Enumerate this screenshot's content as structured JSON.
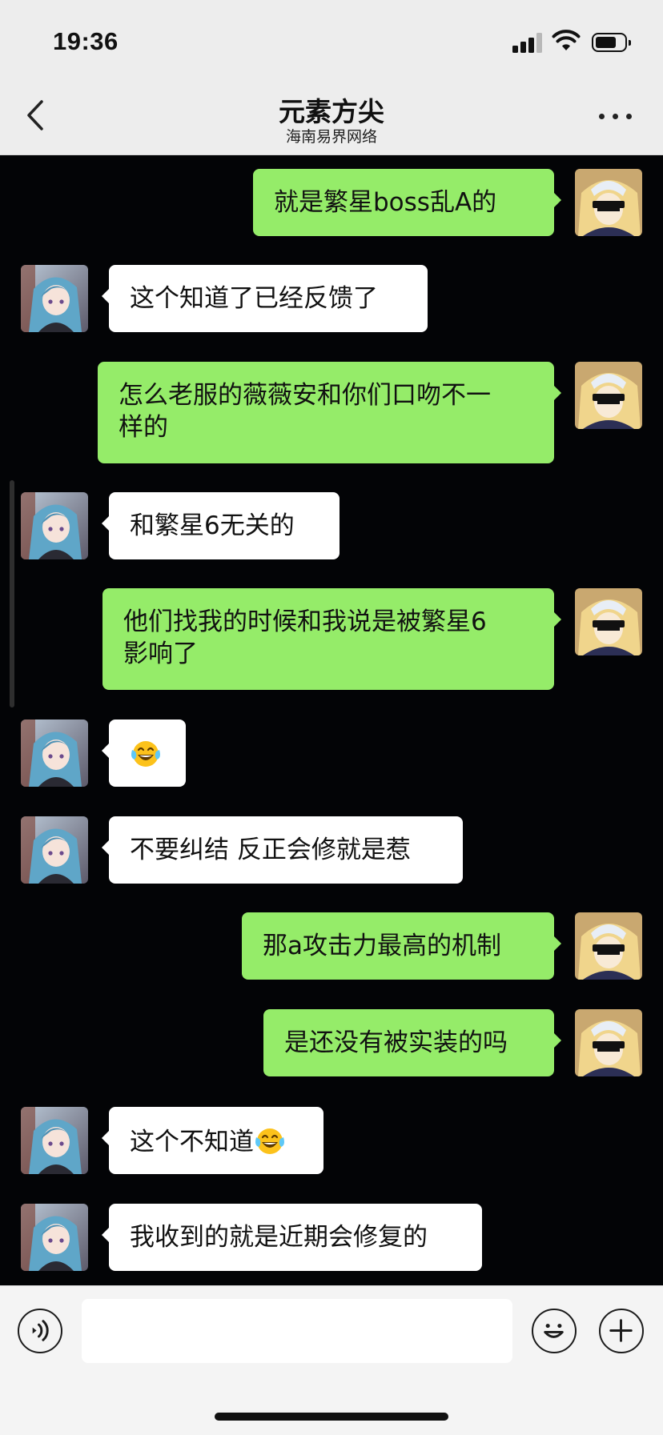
{
  "status_bar": {
    "time": "19:36"
  },
  "header": {
    "title": "元素方尖",
    "subtitle": "海南易界网络"
  },
  "messages": [
    {
      "side": "me",
      "text": "就是繁星boss乱A的"
    },
    {
      "side": "you",
      "text": "这个知道了已经反馈了"
    },
    {
      "side": "me",
      "text": "怎么老服的薇薇安和你们口吻不一\n样的"
    },
    {
      "side": "you",
      "text": "和繁星6无关的"
    },
    {
      "side": "me",
      "text": "他们找我的时候和我说是被繁星6\n影响了"
    },
    {
      "side": "you",
      "text": "",
      "emoji": "laughing-tears-emoji"
    },
    {
      "side": "you",
      "text": "不要纠结 反正会修就是惹"
    },
    {
      "side": "me",
      "text": "那a攻击力最高的机制"
    },
    {
      "side": "me",
      "text": "是还没有被实装的吗"
    },
    {
      "side": "you",
      "text": "这个不知道",
      "emoji": "laughing-tears-emoji"
    },
    {
      "side": "you",
      "text": "我收到的就是近期会修复的"
    }
  ],
  "input_bar": {
    "text_value": "",
    "placeholder": ""
  },
  "icons": {
    "back": "chevron-left-icon",
    "more": "ellipsis-icon",
    "voice": "voice-icon",
    "emoji": "emoji-icon",
    "add": "plus-icon"
  },
  "colors": {
    "header_bg": "#ededed",
    "chat_bg": "#030406",
    "my_bubble": "#95ec69",
    "their_bubble": "#ffffff",
    "input_bar_bg": "#f4f4f4"
  }
}
